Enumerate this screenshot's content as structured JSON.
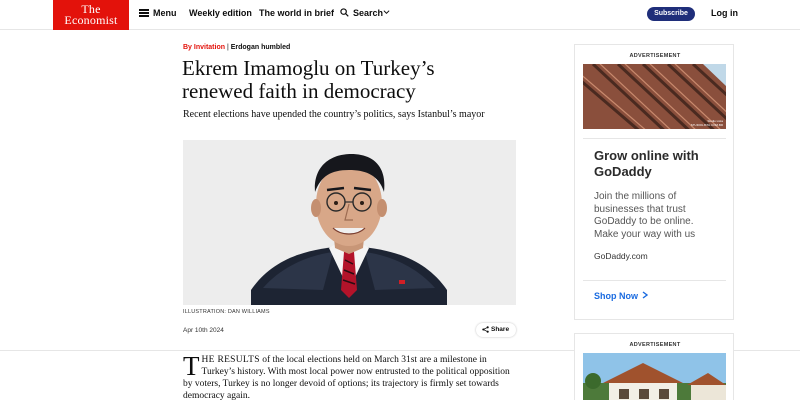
{
  "header": {
    "logo_line1": "The",
    "logo_line2": "Economist",
    "menu_label": "Menu",
    "weekly_edition": "Weekly edition",
    "world_in_brief": "The world in brief",
    "search_label": "Search",
    "subscribe_label": "Subscribe",
    "login_label": "Log in",
    "brand_color": "#e3120b",
    "subscribe_color": "#1f2e7a"
  },
  "article": {
    "rubric": "By Invitation",
    "rubric_sep": " | ",
    "subrubric": "Erdogan humbled",
    "headline": "Ekrem Imamoglu on Turkey’s renewed faith in democracy",
    "standfirst": "Recent elections have upended the country’s politics, says Istanbul’s mayor",
    "image_caption": "ILLUSTRATION: DAN WILLIAMS",
    "date": "Apr 10th 2024",
    "share_label": "Share",
    "dropcap": "T",
    "lead_smallcaps": "HE RESULTS",
    "body": " of the local elections held on March 31st are a milestone in Turkey’s history. With most local power now entrusted to the political opposition by voters, Turkey is no longer devoid of options; its trajectory is firmly set towards democracy again."
  },
  "ads": {
    "label": "ADVERTISEMENT",
    "image_credit_line1": "Studio Lista",
    "image_credit_line2": "STUDIOLISTA.COM.BR",
    "title": "Grow online with GoDaddy",
    "body": "Join the millions of businesses that trust GoDaddy to be online. Make your way with us",
    "domain": "GoDaddy.com",
    "cta": "Shop Now",
    "cta_color": "#1a6be0",
    "second_label": "ADVERTISEMENT"
  }
}
